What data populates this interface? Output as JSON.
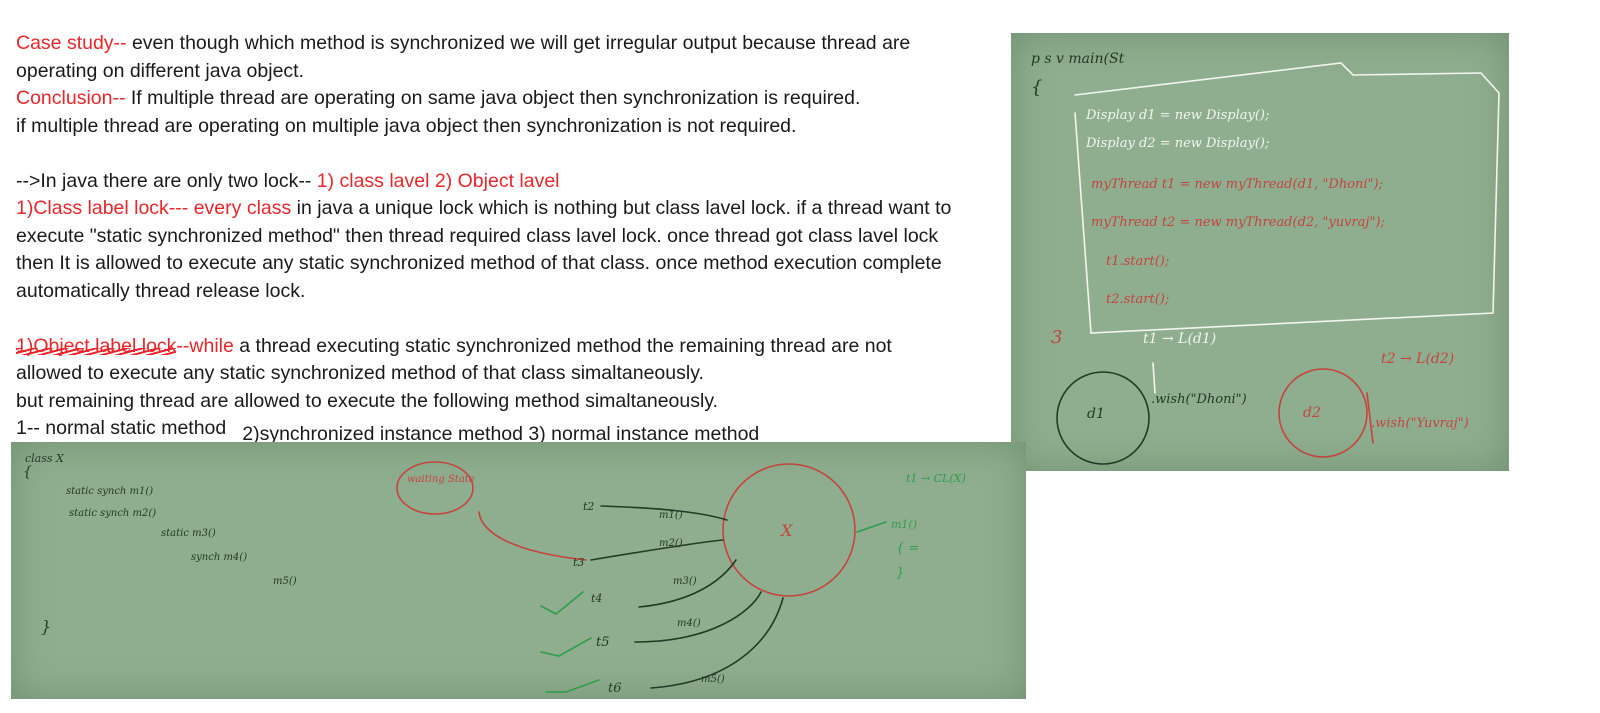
{
  "notes": {
    "case_label": "Case study--",
    "case_text": " even though which method is synchronized we will get irregular output because thread are",
    "case_text_2": "operating on different java object.",
    "conclusion_label": "Conclusion--",
    "conclusion_text": " If multiple thread are operating on same java object then synchronization is required.",
    "conclusion_text_2": "if multiple thread are operating on multiple java object then synchronization is not required.",
    "lock_intro": "-->In java there are only two lock-- ",
    "lock_types": "1) class lavel  2) Object lavel",
    "class_lock_label": "1)Class label lock---",
    "class_lock_every": " every class",
    "class_lock_text": " in java a unique lock which is nothing but class lavel lock. if a thread want to",
    "class_lock_text_2": "execute \"static synchronized method\" then thread required class lavel lock. once thread got class lavel lock",
    "class_lock_text_3": "then It is allowed to execute any static synchronized method of that class. once method execution complete",
    "class_lock_text_4": "automatically thread release lock.",
    "struck_label": "1)Object label lock",
    "while_label": "--while",
    "while_text": " a thread executing static synchronized  method the remaining thread are not",
    "while_text_2": "allowed to execute any static synchronized  method of that class simaltaneously.",
    "while_text_3": "but remaining thread are allowed to execute the following method simaltaneously.",
    "list_item_1": "1-- normal static method",
    "list_item_2": "2)synchronized  instance method   3) normal instance method"
  },
  "right_board": {
    "code_lines": [
      "Display d1 = new Display();",
      "Display d2 = new Display();",
      "myThread t1 = new myThread(d1, \"Dhoni\");",
      "myThread t2 = new myThread(d2, \"yuvraj\");",
      "t1.start();",
      "t2.start();"
    ],
    "header": "p s v main(St",
    "t1_lock": "t1 → L(d1)",
    "t2_lock": "t2 → L(d2)",
    "circle_d1": "d1",
    "circle_d2": "d2",
    "wish_dhoni": ".wish(\"Dhoni\")",
    "wish_yuvraj": ".wish(\"Yuvraj\")"
  },
  "bottom_board": {
    "class_header": "class X",
    "methods": [
      "static synch m1()",
      "static synch m2()",
      "static m3()",
      "synch m4()",
      "m5()"
    ],
    "waiting_state": "waiting State",
    "object_x": "X",
    "threads": [
      "t2",
      "t3",
      "t4",
      "t5",
      "t6"
    ],
    "calls": [
      "m1()",
      "m2()",
      "m3()",
      "m4()",
      "m5()"
    ],
    "t1_lock": "t1 → CL(X)",
    "t1_method": "m1()"
  },
  "colors": {
    "red_text": "#e8262b",
    "board": "#8fae8f"
  }
}
